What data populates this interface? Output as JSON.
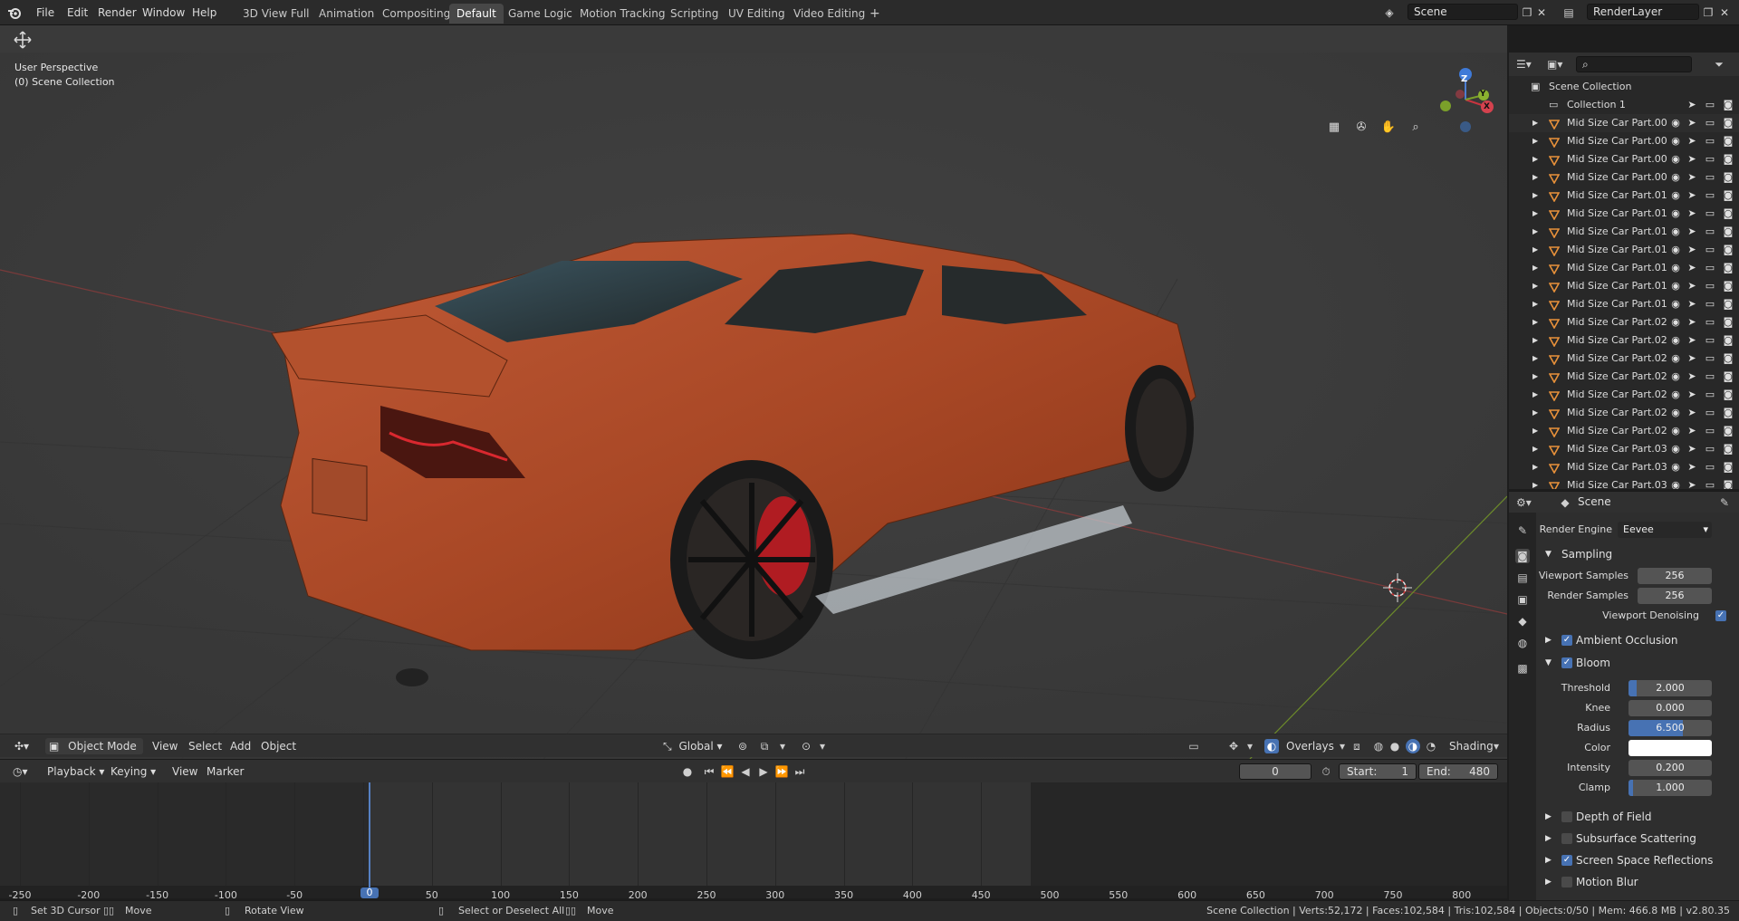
{
  "top_menu": {
    "items": [
      "File",
      "Edit",
      "Render",
      "Window",
      "Help"
    ],
    "workspaces": [
      "3D View Full",
      "Animation",
      "Compositing",
      "Default",
      "Game Logic",
      "Motion Tracking",
      "Scripting",
      "UV Editing",
      "Video Editing"
    ],
    "active_workspace": "Default",
    "add_tab": "+",
    "scene_name": "Scene",
    "render_layer": "RenderLayer"
  },
  "viewport": {
    "perspective": "User Perspective",
    "collection": "(0) Scene Collection",
    "gizmo": {
      "z": "Z",
      "y": "Y",
      "x": "X"
    }
  },
  "viewport_header": {
    "mode": "Object Mode",
    "menus": [
      "View",
      "Select",
      "Add",
      "Object"
    ],
    "orientation": "Global",
    "overlays": "Overlays",
    "shading": "Shading"
  },
  "timeline_header": {
    "menus": [
      "Playback",
      "Keying",
      "View",
      "Marker"
    ],
    "current_frame": "0",
    "start_label": "Start:",
    "start_value": "1",
    "end_label": "End:",
    "end_value": "480"
  },
  "timeline": {
    "ticks": [
      "-250",
      "-200",
      "-150",
      "-100",
      "-50",
      "0",
      "50",
      "100",
      "150",
      "200",
      "250",
      "300",
      "350",
      "400",
      "450",
      "500",
      "550",
      "600",
      "650",
      "700",
      "750",
      "800"
    ],
    "current": "0"
  },
  "statusbar": {
    "left": [
      "Set 3D Cursor",
      "Move",
      "Rotate View",
      "Select or Deselect All",
      "Move"
    ],
    "right": "Scene Collection | Verts:52,172 | Faces:102,584 | Tris:102,584 | Objects:0/50 | Mem: 466.8 MB | v2.80.35"
  },
  "outliner": {
    "root": "Scene Collection",
    "collection": "Collection 1",
    "objects": [
      "Mid Size Car Part.00",
      "Mid Size Car Part.00",
      "Mid Size Car Part.00",
      "Mid Size Car Part.00",
      "Mid Size Car Part.01",
      "Mid Size Car Part.01",
      "Mid Size Car Part.01",
      "Mid Size Car Part.01",
      "Mid Size Car Part.01",
      "Mid Size Car Part.01",
      "Mid Size Car Part.01",
      "Mid Size Car Part.02",
      "Mid Size Car Part.02",
      "Mid Size Car Part.02",
      "Mid Size Car Part.02",
      "Mid Size Car Part.02",
      "Mid Size Car Part.02",
      "Mid Size Car Part.02",
      "Mid Size Car Part.03",
      "Mid Size Car Part.03",
      "Mid Size Car Part.03"
    ]
  },
  "properties": {
    "context": "Scene",
    "render_engine_label": "Render Engine",
    "render_engine": "Eevee",
    "sampling": "Sampling",
    "viewport_samples_label": "Viewport Samples",
    "viewport_samples": "256",
    "render_samples_label": "Render Samples",
    "render_samples": "256",
    "viewport_denoising": "Viewport Denoising",
    "ambient_occlusion": "Ambient Occlusion",
    "bloom": "Bloom",
    "threshold_label": "Threshold",
    "threshold": "2.000",
    "threshold_fill": 0.1,
    "knee_label": "Knee",
    "knee": "0.000",
    "radius_label": "Radius",
    "radius": "6.500",
    "radius_fill": 0.65,
    "color_label": "Color",
    "intensity_label": "Intensity",
    "intensity": "0.200",
    "clamp_label": "Clamp",
    "clamp": "1.000",
    "clamp_fill": 0.05,
    "depth_of_field": "Depth of Field",
    "subsurface_scattering": "Subsurface Scattering",
    "screen_space_reflections": "Screen Space Reflections",
    "motion_blur": "Motion Blur"
  },
  "colors": {
    "accent": "#4772b3",
    "car_body": "#b5502e",
    "brake": "#c0222a",
    "axis_x": "#c8343f",
    "axis_y": "#7ba02a"
  }
}
